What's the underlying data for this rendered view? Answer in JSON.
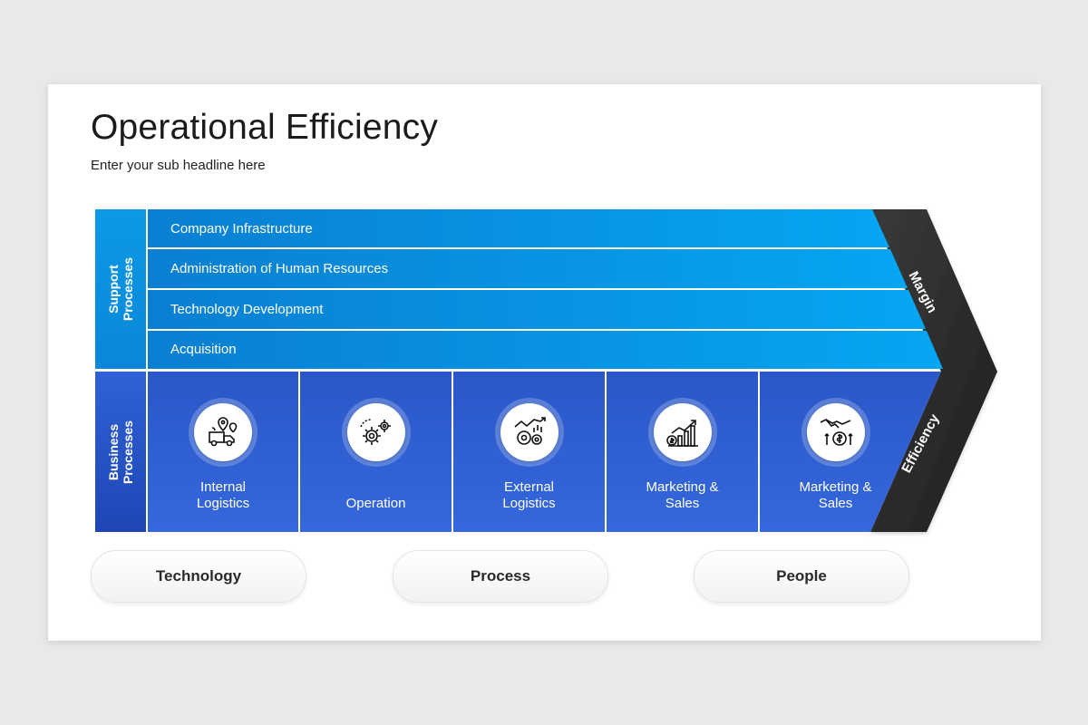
{
  "slide": {
    "title": "Operational Efficiency",
    "subtitle": "Enter your sub headline here"
  },
  "side_labels": {
    "support": [
      "Support",
      "Processes"
    ],
    "business": [
      "Business",
      "Processes"
    ]
  },
  "support_rows": [
    "Company Infrastructure",
    "Administration of Human Resources",
    "Technology Development",
    "Acquisition"
  ],
  "business_cells": [
    {
      "line1": "Internal",
      "line2": "Logistics",
      "icon": "logistics-icon"
    },
    {
      "line1": "",
      "line2": "Operation",
      "icon": "gears-icon"
    },
    {
      "line1": "External",
      "line2": "Logistics",
      "icon": "chart-gears-icon"
    },
    {
      "line1": "Marketing &",
      "line2": "Sales",
      "icon": "growth-chart-icon"
    },
    {
      "line1": "Marketing &",
      "line2": "Sales",
      "icon": "handshake-money-icon"
    }
  ],
  "chevron": {
    "top": "Margin",
    "bottom": "Efficiency"
  },
  "pills": [
    "Technology",
    "Process",
    "People"
  ],
  "colors": {
    "support_blue": "#0b9be8",
    "business_blue": "#2f62d3",
    "chevron_dark": "#2b2b2b"
  }
}
